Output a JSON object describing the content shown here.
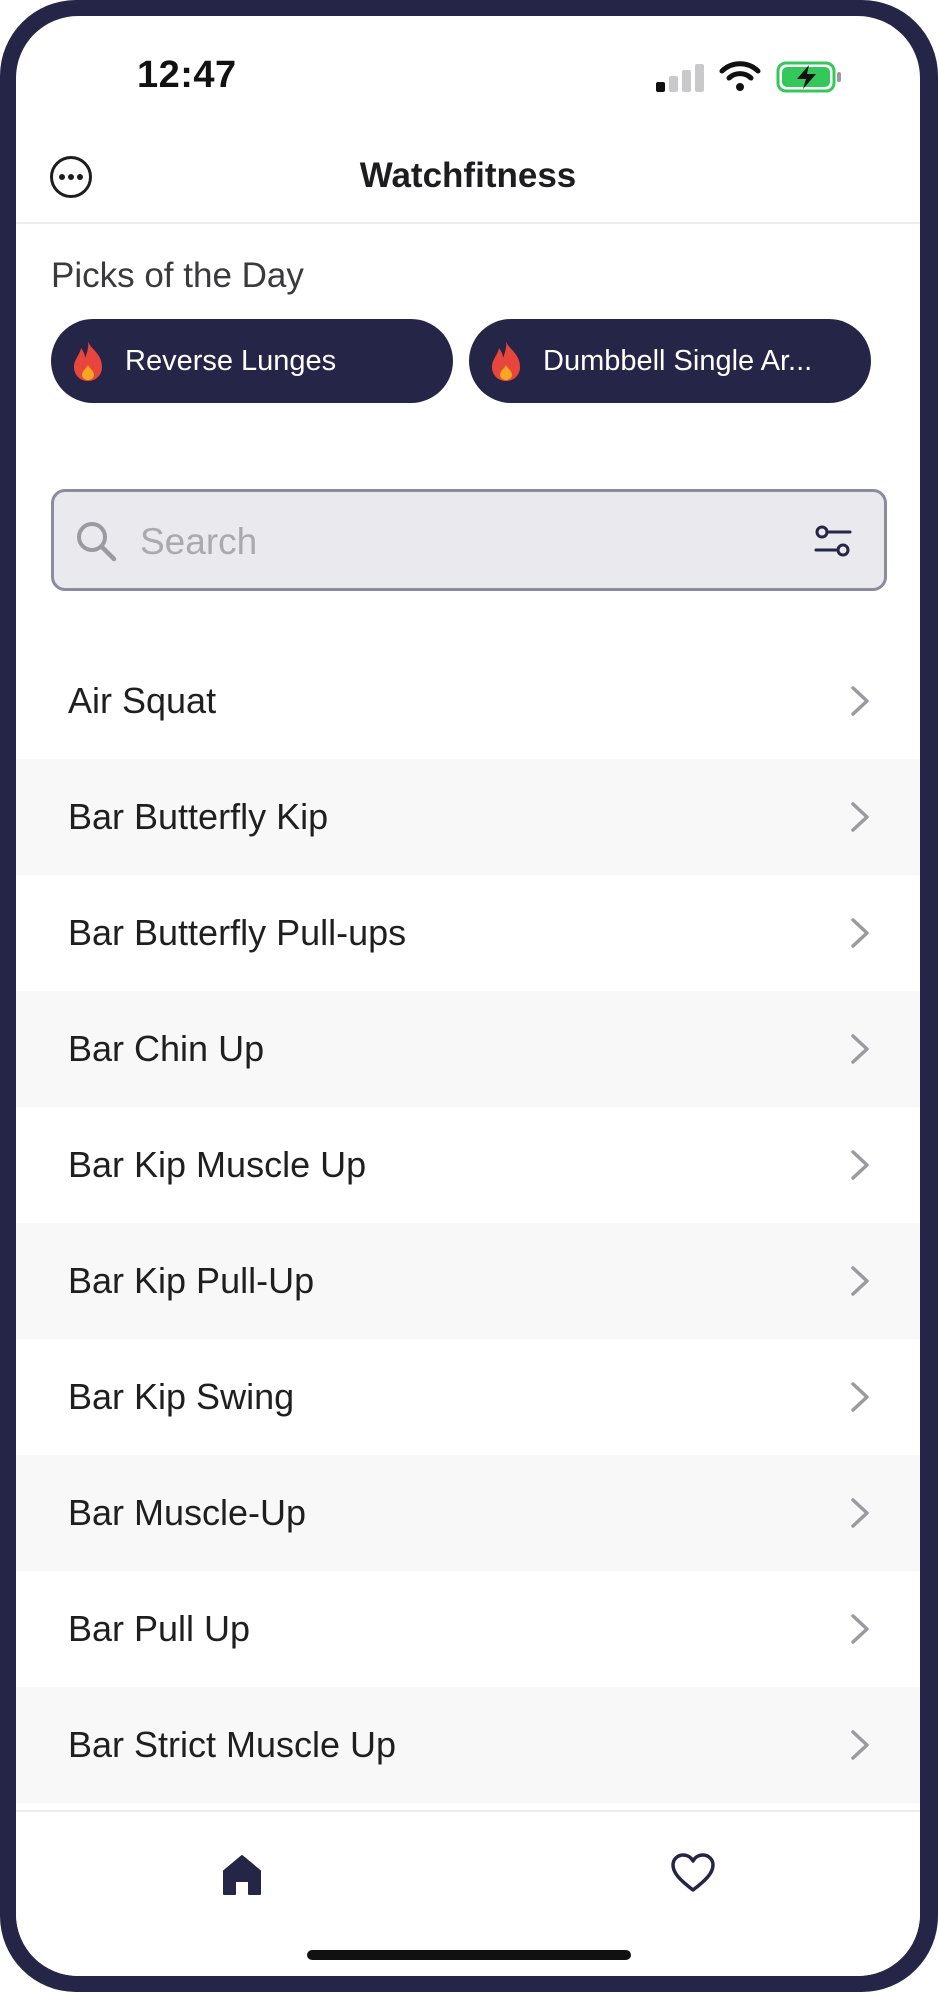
{
  "status_bar": {
    "time": "12:47",
    "icons": [
      "cellular-signal-icon",
      "wifi-icon",
      "battery-charging-icon"
    ]
  },
  "header": {
    "title": "Watchfitness",
    "menu_icon": "more-ellipsis-icon"
  },
  "picks": {
    "title": "Picks of the Day",
    "items": [
      {
        "label": "Reverse Lunges",
        "icon": "flame-icon"
      },
      {
        "label": "Dumbbell Single Ar...",
        "icon": "flame-icon"
      }
    ]
  },
  "search": {
    "value": "",
    "placeholder": "Search",
    "icon": "search-icon",
    "filter_icon": "filter-sliders-icon"
  },
  "exercises": [
    "Air Squat",
    "Bar Butterfly Kip",
    "Bar Butterfly Pull-ups",
    "Bar Chin Up",
    "Bar Kip Muscle Up",
    "Bar Kip Pull-Up",
    "Bar Kip Swing",
    "Bar Muscle-Up",
    "Bar Pull Up",
    "Bar Strict Muscle Up"
  ],
  "tabbar": {
    "tabs": [
      {
        "name": "home",
        "icon": "home-icon",
        "active": true
      },
      {
        "name": "favorites",
        "icon": "heart-icon",
        "active": false
      }
    ]
  },
  "colors": {
    "accent": "#252548",
    "chip_background": "#252548",
    "flame": "#e8453c",
    "row_alt": "#f8f8f8",
    "battery": "#34c759"
  }
}
